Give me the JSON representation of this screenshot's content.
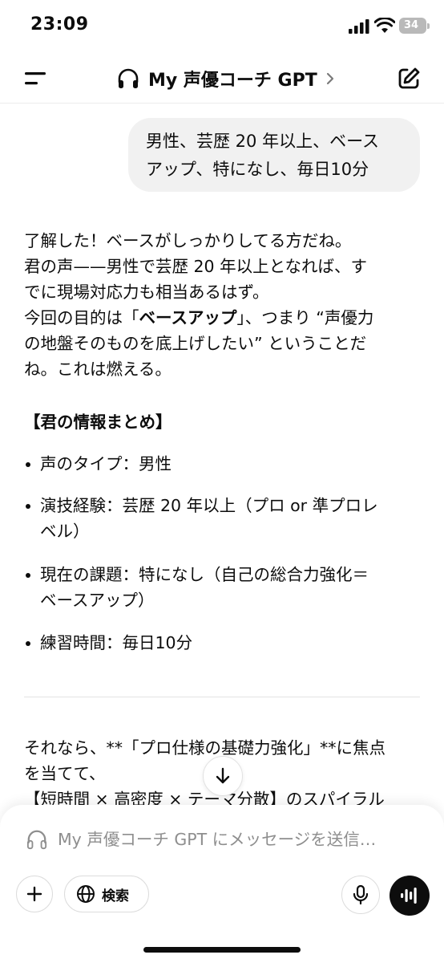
{
  "status_bar": {
    "time": "23:09",
    "battery": "34"
  },
  "header": {
    "title": "My 声優コーチ GPT"
  },
  "user_message": {
    "lines": [
      "男性、芸歴 20 年以上、ベース",
      "アップ、特になし、毎日10分"
    ]
  },
  "assistant": {
    "intro": {
      "line1": "了解した！ベースがしっかりしてる方だね。",
      "line2": "君の声——男性で芸歴 20 年以上となれば、す",
      "line3": "でに現場対応力も相当あるはず。",
      "line4_pre": "今回の目的は「",
      "line4_bold": "ベースアップ",
      "line4_post": "」、つまり “声優力",
      "line5": "の地盤そのものを底上げしたい” ということだ",
      "line6": "ね。これは燃える。"
    },
    "section_title": "【君の情報まとめ】",
    "bullets": {
      "b1": "声のタイプ：男性",
      "b2_line1": "演技経験：芸歴 20 年以上（プロ or 準プロレ",
      "b2_line2": "ベル）",
      "b3_line1": "現在の課題：特になし（自己の総合力強化＝",
      "b3_line2": "ベースアップ）",
      "b4": "練習時間：毎日10分"
    },
    "next": {
      "line1": "それなら、**「プロ仕様の基礎力強化」**に焦点",
      "line2": "を当てて、",
      "line3": "【短時間 × 高密度 × テーマ分散】のスパイラル"
    }
  },
  "composer": {
    "placeholder": "My 声優コーチ GPT にメッセージを送信…",
    "search_label": "検索"
  },
  "icons": {
    "menu": "menu-icon",
    "headphones": "headphones-icon",
    "chevron": "chevron-right-icon",
    "edit": "edit-icon",
    "arrow_down": "arrow-down-icon",
    "plus": "plus-icon",
    "globe": "globe-icon",
    "mic": "microphone-icon",
    "voice": "voice-mode-icon"
  }
}
